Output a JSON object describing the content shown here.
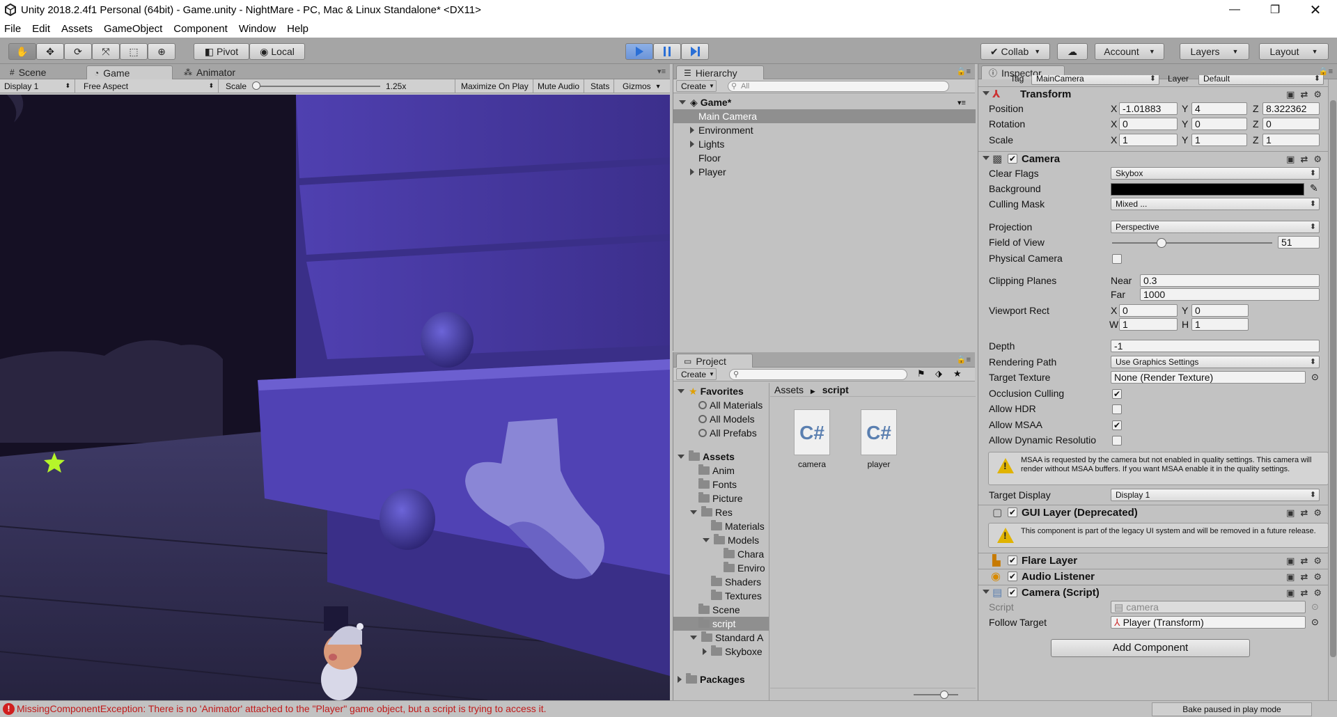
{
  "window": {
    "title": "Unity 2018.2.4f1 Personal (64bit) - Game.unity - NightMare - PC, Mac & Linux Standalone* <DX11>"
  },
  "menu": [
    "File",
    "Edit",
    "Assets",
    "GameObject",
    "Component",
    "Window",
    "Help"
  ],
  "toolbar": {
    "pivot": "Pivot",
    "local": "Local",
    "collab": "Collab",
    "account": "Account",
    "layers": "Layers",
    "layout": "Layout"
  },
  "left_tabs": {
    "scene": "Scene",
    "game": "Game",
    "animator": "Animator"
  },
  "game_bar": {
    "display": "Display 1",
    "aspect": "Free Aspect",
    "scale_label": "Scale",
    "scale_value": "1.25x",
    "maximize": "Maximize On Play",
    "mute": "Mute Audio",
    "stats": "Stats",
    "gizmos": "Gizmos"
  },
  "hierarchy": {
    "tab": "Hierarchy",
    "create": "Create",
    "search_placeholder": "All",
    "scene": "Game*",
    "items": [
      "Main Camera",
      "Environment",
      "Lights",
      "Floor",
      "Player"
    ]
  },
  "project": {
    "tab": "Project",
    "create": "Create",
    "favorites": "Favorites",
    "fav_items": [
      "All Materials",
      "All Models",
      "All Prefabs"
    ],
    "assets": "Assets",
    "tree": [
      {
        "label": "Anim",
        "level": 1,
        "arrow": "none"
      },
      {
        "label": "Fonts",
        "level": 1,
        "arrow": "none"
      },
      {
        "label": "Picture",
        "level": 1,
        "arrow": "none"
      },
      {
        "label": "Res",
        "level": 1,
        "arrow": "down"
      },
      {
        "label": "Materials",
        "level": 2,
        "arrow": "none"
      },
      {
        "label": "Models",
        "level": 2,
        "arrow": "down"
      },
      {
        "label": "Chara",
        "level": 3,
        "arrow": "none"
      },
      {
        "label": "Enviro",
        "level": 3,
        "arrow": "none"
      },
      {
        "label": "Shaders",
        "level": 2,
        "arrow": "none"
      },
      {
        "label": "Textures",
        "level": 2,
        "arrow": "none"
      },
      {
        "label": "Scene",
        "level": 1,
        "arrow": "none"
      },
      {
        "label": "script",
        "level": 1,
        "arrow": "none",
        "selected": true
      },
      {
        "label": "Standard A",
        "level": 1,
        "arrow": "down"
      },
      {
        "label": "Skyboxe",
        "level": 2,
        "arrow": "right"
      }
    ],
    "packages": "Packages",
    "breadcrumb_root": "Assets",
    "breadcrumb_current": "script",
    "files": [
      {
        "name": "camera",
        "type": "C#"
      },
      {
        "name": "player",
        "type": "C#"
      }
    ]
  },
  "inspector": {
    "tab": "Inspector",
    "tag_label": "Tag",
    "tag_value": "MainCamera",
    "layer_label": "Layer",
    "layer_value": "Default",
    "transform": {
      "title": "Transform",
      "position_label": "Position",
      "px": "-1.01883",
      "py": "4",
      "pz": "8.322362",
      "rotation_label": "Rotation",
      "rx": "0",
      "ry": "0",
      "rz": "0",
      "scale_label": "Scale",
      "sx": "1",
      "sy": "1",
      "sz": "1"
    },
    "camera": {
      "title": "Camera",
      "clear_flags_label": "Clear Flags",
      "clear_flags": "Skybox",
      "background_label": "Background",
      "culling_mask_label": "Culling Mask",
      "culling_mask": "Mixed ...",
      "projection_label": "Projection",
      "projection": "Perspective",
      "fov_label": "Field of View",
      "fov": "51",
      "fov_fraction": 0.31,
      "physical_label": "Physical Camera",
      "clipping_label": "Clipping Planes",
      "near_label": "Near",
      "near": "0.3",
      "far_label": "Far",
      "far": "1000",
      "viewport_label": "Viewport Rect",
      "vx": "0",
      "vy": "0",
      "vw": "1",
      "vh": "1",
      "depth_label": "Depth",
      "depth": "-1",
      "rendering_path_label": "Rendering Path",
      "rendering_path": "Use Graphics Settings",
      "target_texture_label": "Target Texture",
      "target_texture": "None (Render Texture)",
      "occlusion_label": "Occlusion Culling",
      "hdr_label": "Allow HDR",
      "msaa_label": "Allow MSAA",
      "dynres_label": "Allow Dynamic Resolutio",
      "msaa_warning": "MSAA is requested by the camera but not enabled in quality settings. This camera will render without MSAA buffers. If you want MSAA enable it in the quality settings.",
      "target_display_label": "Target Display",
      "target_display": "Display 1"
    },
    "gui_layer": {
      "title": "GUI Layer (Deprecated)",
      "info": "This component is part of the legacy UI system and will be removed in a future release."
    },
    "flare_layer": {
      "title": "Flare Layer"
    },
    "audio_listener": {
      "title": "Audio Listener"
    },
    "camera_script": {
      "title": "Camera (Script)",
      "script_label": "Script",
      "script": "camera",
      "follow_label": "Follow Target",
      "follow": "Player (Transform)"
    },
    "add_component": "Add Component"
  },
  "status": {
    "error": "MissingComponentException: There is no 'Animator' attached to the \"Player\" game object, but a script is trying to access it.",
    "bake": "Bake paused in play mode"
  },
  "colors": {
    "play_blue": "#2a6fd6",
    "drawer_purple": "#4a3ca6",
    "error_red": "#d01f1f",
    "star_green": "#b6f52a"
  }
}
